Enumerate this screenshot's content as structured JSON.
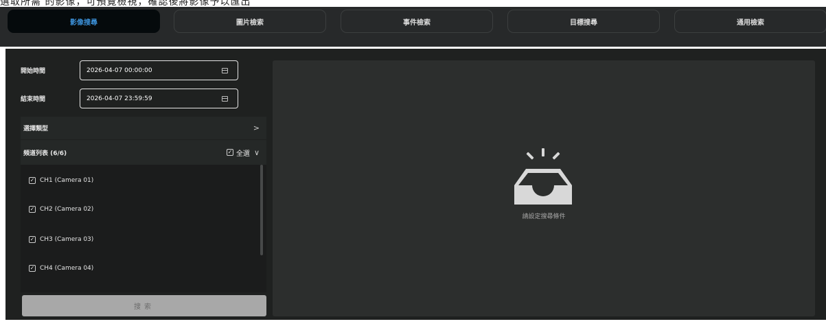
{
  "caption": "選取所需 的影像，可預覽檢視，確認後將影像予以匯出",
  "tabs": [
    {
      "label": "影像搜尋",
      "active": true
    },
    {
      "label": "圖片檢索",
      "active": false
    },
    {
      "label": "事件檢索",
      "active": false
    },
    {
      "label": "目標搜尋",
      "active": false
    },
    {
      "label": "通用檢索",
      "active": false
    }
  ],
  "form": {
    "start_label": "開始時間",
    "start_value": "2026-04-07 00:00:00",
    "end_label": "結束時間",
    "end_value": "2026-04-07 23:59:59",
    "type_label": "選擇類型",
    "type_chevron": ">",
    "channel_list_label": "頻道列表 (6/6)",
    "select_all_label": "全選",
    "channel_chevron": "∨",
    "channels": [
      {
        "label": "CH1 (Camera 01)",
        "checked": true
      },
      {
        "label": "CH2 (Camera 02)",
        "checked": true
      },
      {
        "label": "CH3 (Camera 03)",
        "checked": true
      },
      {
        "label": "CH4 (Camera 04)",
        "checked": true
      }
    ],
    "search_button": "搜索"
  },
  "results": {
    "empty_message": "請設定搜尋條件"
  },
  "colors": {
    "accent": "#3b8fd6",
    "background": "#1f2120",
    "tab_active": "#050a0c"
  }
}
